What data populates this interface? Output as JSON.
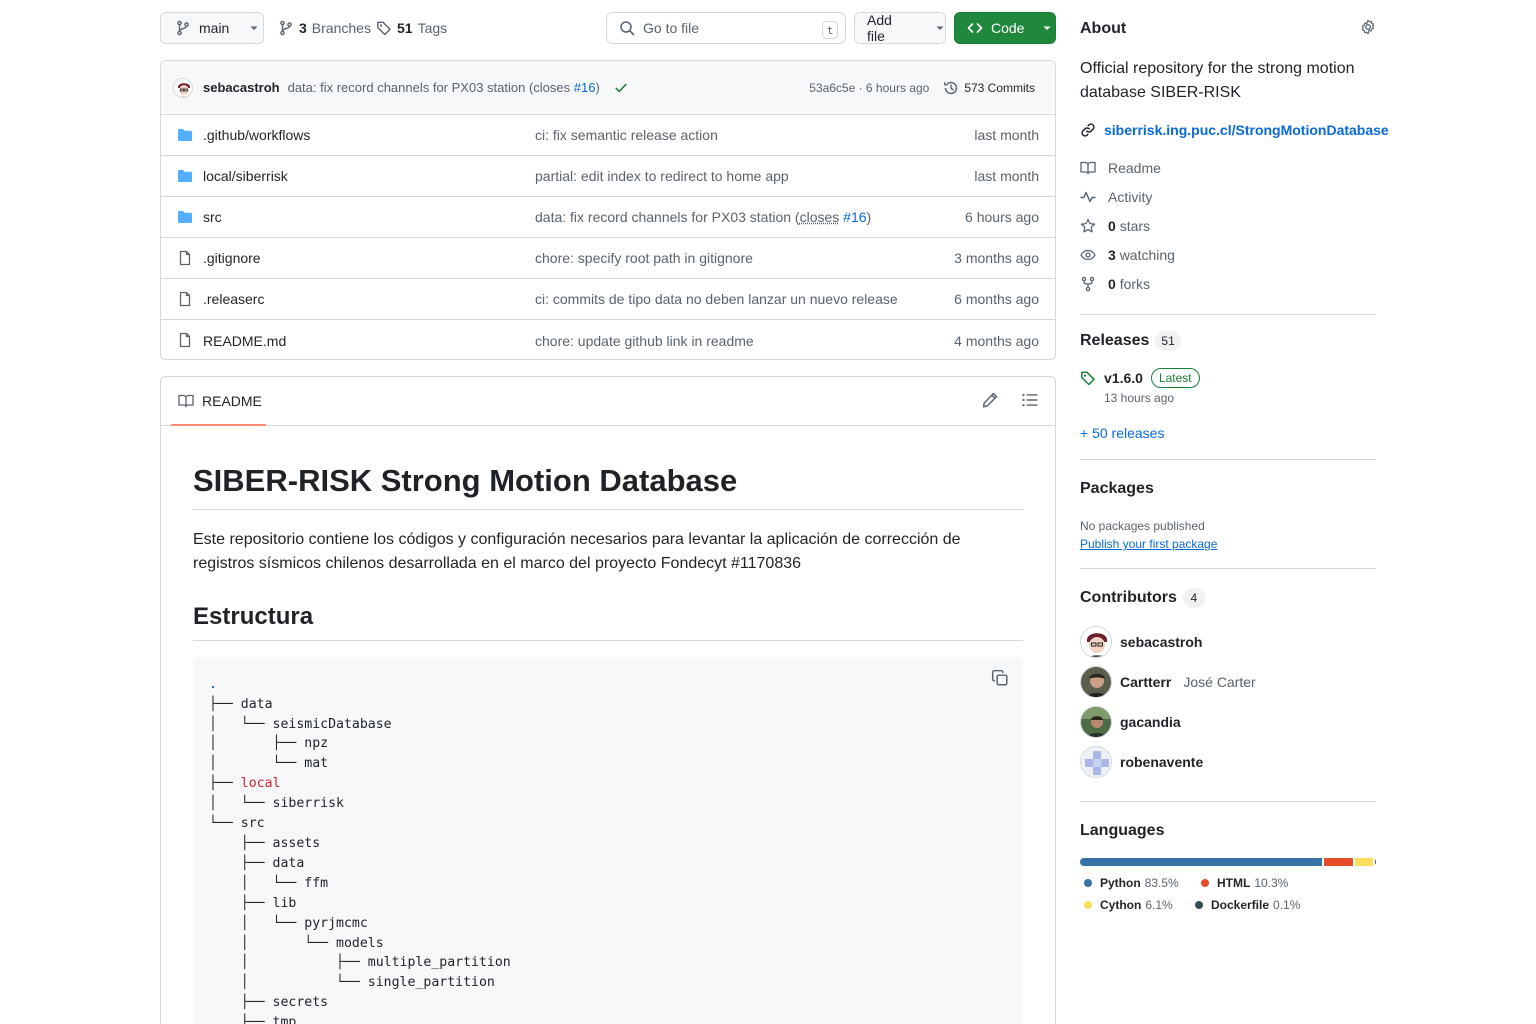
{
  "toolbar": {
    "branch": "main",
    "branches_count": "3",
    "branches_label": "Branches",
    "tags_count": "51",
    "tags_label": "Tags",
    "search_placeholder": "Go to file",
    "search_shortcut": "t",
    "add_file_label": "Add file",
    "code_label": "Code"
  },
  "latest_commit": {
    "author": "sebacastroh",
    "message_prefix": "data: fix record channels for PX03 station (closes ",
    "issue_ref": "#16",
    "message_suffix": ")",
    "sha_time": "53a6c5e · 6 hours ago",
    "commits_label": "573 Commits"
  },
  "files": [
    {
      "type": "folder",
      "name": ".github/workflows",
      "commit": "ci: fix semantic release action",
      "time": "last month"
    },
    {
      "type": "folder",
      "name": "local/siberrisk",
      "commit": "partial: edit index to redirect to home app",
      "time": "last month"
    },
    {
      "type": "folder",
      "name": "src",
      "commit_prefix": "data: fix record channels for PX03 station (",
      "commit_closes": "closes",
      "commit_ref": "#16",
      "commit_suffix": ")",
      "time": "6 hours ago"
    },
    {
      "type": "file",
      "name": ".gitignore",
      "commit": "chore: specify root path in gitignore",
      "time": "3 months ago"
    },
    {
      "type": "file",
      "name": ".releaserc",
      "commit": "ci: commits de tipo data no deben lanzar un nuevo release",
      "time": "6 months ago"
    },
    {
      "type": "file",
      "name": "README.md",
      "commit": "chore: update github link in readme",
      "time": "4 months ago"
    }
  ],
  "readme": {
    "tab_label": "README",
    "title": "SIBER-RISK Strong Motion Database",
    "intro": "Este repositorio contiene los códigos y configuración necesarios para levantar la aplicación de corrección de registros sísmicos chilenos desarrollada en el marco del proyecto Fondecyt #1170836",
    "structure_heading": "Estructura",
    "tree": [
      {
        "prefix": "",
        "name": ".",
        "style": "dot"
      },
      {
        "prefix": "├── ",
        "name": "data",
        "style": ""
      },
      {
        "prefix": "│   └── ",
        "name": "seismicDatabase",
        "style": ""
      },
      {
        "prefix": "│       ├── ",
        "name": "npz",
        "style": ""
      },
      {
        "prefix": "│       └── ",
        "name": "mat",
        "style": ""
      },
      {
        "prefix": "├── ",
        "name": "local",
        "style": "red"
      },
      {
        "prefix": "│   └── ",
        "name": "siberrisk",
        "style": ""
      },
      {
        "prefix": "└── ",
        "name": "src",
        "style": ""
      },
      {
        "prefix": "    ├── ",
        "name": "assets",
        "style": ""
      },
      {
        "prefix": "    ├── ",
        "name": "data",
        "style": ""
      },
      {
        "prefix": "    │   └── ",
        "name": "ffm",
        "style": ""
      },
      {
        "prefix": "    ├── ",
        "name": "lib",
        "style": ""
      },
      {
        "prefix": "    │   └── ",
        "name": "pyrjmcmc",
        "style": ""
      },
      {
        "prefix": "    │       └── ",
        "name": "models",
        "style": ""
      },
      {
        "prefix": "    │           ├── ",
        "name": "multiple_partition",
        "style": ""
      },
      {
        "prefix": "    │           └── ",
        "name": "single_partition",
        "style": ""
      },
      {
        "prefix": "    ├── ",
        "name": "secrets",
        "style": ""
      },
      {
        "prefix": "    ├── ",
        "name": "tmp",
        "style": ""
      }
    ]
  },
  "about": {
    "title": "About",
    "description": "Official repository for the strong motion database SIBER-RISK",
    "website": "siberrisk.ing.puc.cl/StrongMotionDatabase",
    "readme_label": "Readme",
    "activity_label": "Activity",
    "stars_count": "0",
    "stars_label": "stars",
    "watching_count": "3",
    "watching_label": "watching",
    "forks_count": "0",
    "forks_label": "forks"
  },
  "releases": {
    "title": "Releases",
    "count": "51",
    "latest_tag": "v1.6.0",
    "latest_badge": "Latest",
    "latest_date": "13 hours ago",
    "more_label": "+ 50 releases"
  },
  "packages": {
    "title": "Packages",
    "empty_text": "No packages published",
    "publish_link": "Publish your first package"
  },
  "contributors": {
    "title": "Contributors",
    "count": "4",
    "list": [
      {
        "login": "sebacastroh",
        "full_name": ""
      },
      {
        "login": "Cartterr",
        "full_name": "José Carter"
      },
      {
        "login": "gacandia",
        "full_name": ""
      },
      {
        "login": "robenavente",
        "full_name": ""
      }
    ]
  },
  "languages": {
    "title": "Languages",
    "items": [
      {
        "name": "Python",
        "percent": "83.5%",
        "value": 83.5,
        "color": "#3572A5"
      },
      {
        "name": "HTML",
        "percent": "10.3%",
        "value": 10.3,
        "color": "#e34c26"
      },
      {
        "name": "Cython",
        "percent": "6.1%",
        "value": 6.1,
        "color": "#fedf5b"
      },
      {
        "name": "Dockerfile",
        "percent": "0.1%",
        "value": 0.1,
        "color": "#384d54"
      }
    ]
  }
}
